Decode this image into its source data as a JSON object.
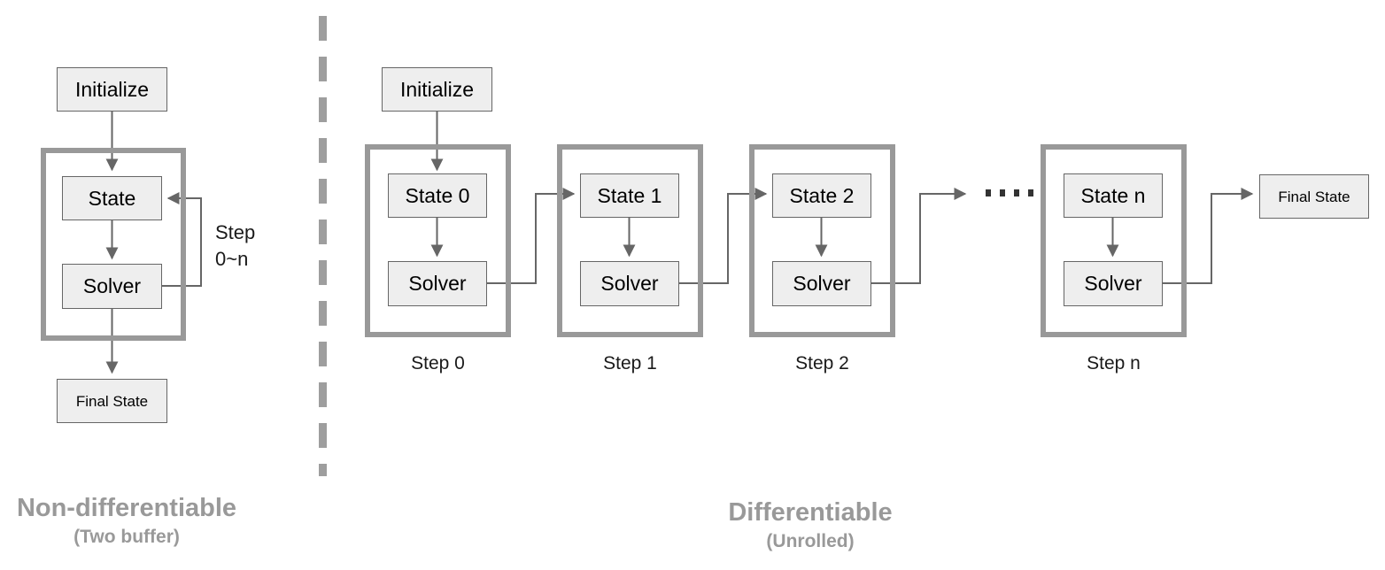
{
  "diagram": {
    "title_hidden": "",
    "colors": {
      "node_fill": "#eeeeee",
      "node_border": "#666666",
      "group_border": "#999999",
      "connector": "#666666",
      "caption_text": "#999999",
      "divider": "#9e9e9e",
      "dot": "#333333"
    },
    "divider": {
      "name": "dashed-vertical-divider"
    }
  },
  "left_panel": {
    "caption": {
      "title": "Non-differentiable",
      "subtitle": "(Two buffer)"
    },
    "initialize": {
      "label": "Initialize"
    },
    "group": {
      "label": ""
    },
    "state": {
      "label": "State"
    },
    "solver": {
      "label": "Solver"
    },
    "final_state": {
      "label": "Final State"
    },
    "loop_label": {
      "line1": "Step",
      "line2": "0~n"
    }
  },
  "right_panel": {
    "caption": {
      "title": "Differentiable",
      "subtitle": "(Unrolled)"
    },
    "initialize": {
      "label": "Initialize"
    },
    "solver_label": "Solver",
    "steps": [
      {
        "state": "State 0",
        "solver": "Solver",
        "step_label": "Step 0"
      },
      {
        "state": "State 1",
        "solver": "Solver",
        "step_label": "Step 1"
      },
      {
        "state": "State 2",
        "solver": "Solver",
        "step_label": "Step 2"
      },
      {
        "state": "State n",
        "solver": "Solver",
        "step_label": "Step n"
      }
    ],
    "ellipsis_dot_count": 4,
    "final_state": {
      "label": "Final State"
    }
  }
}
